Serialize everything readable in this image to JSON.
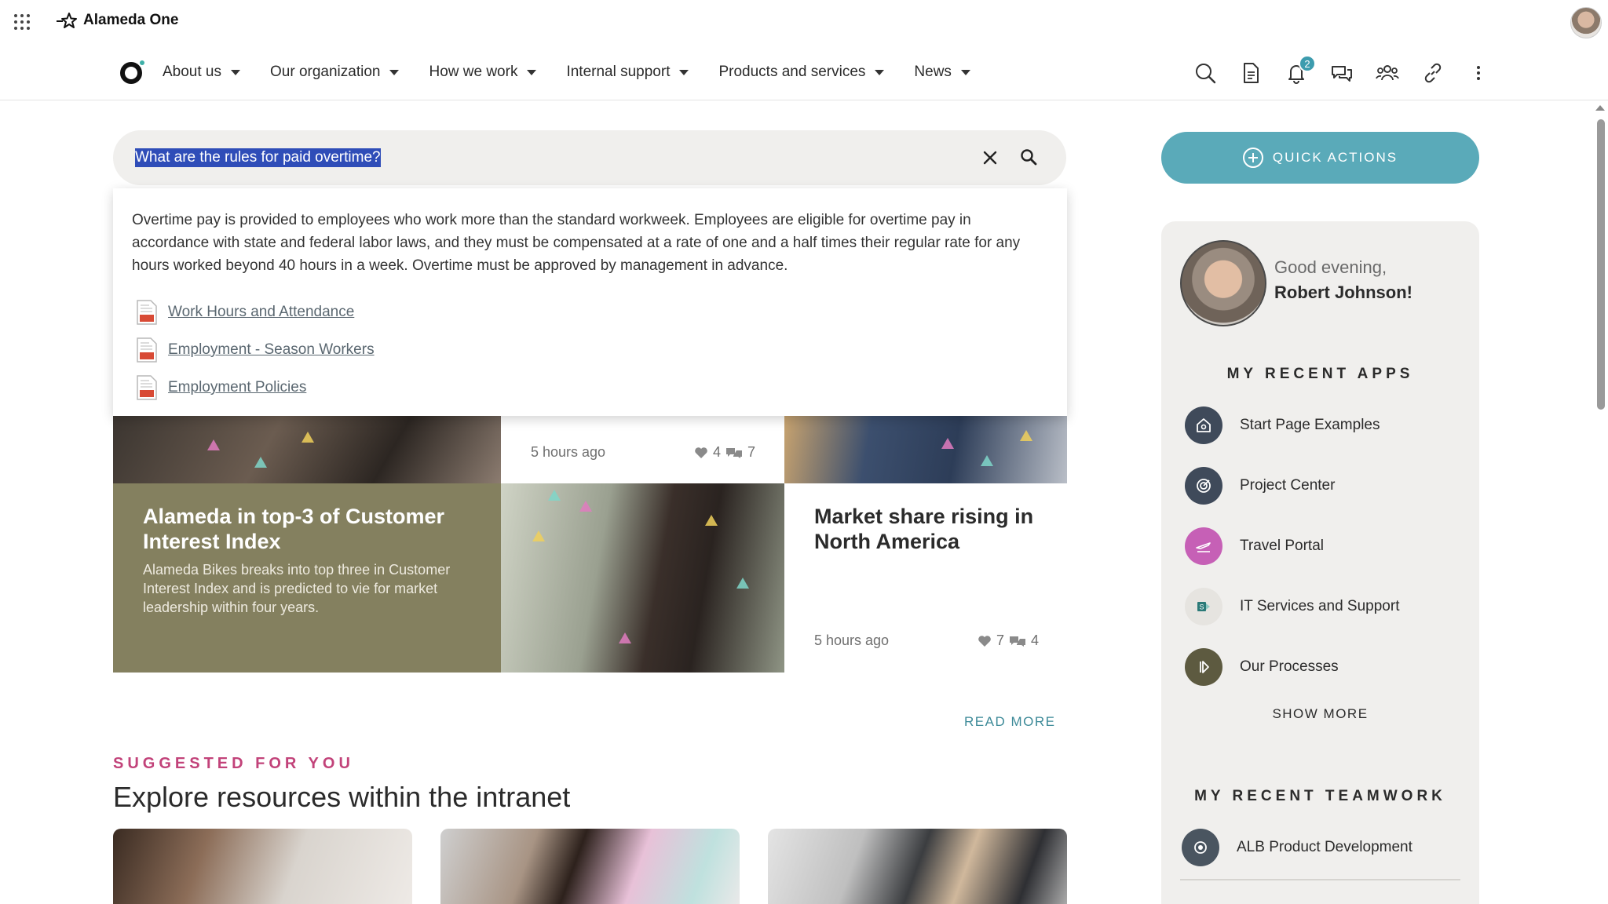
{
  "brand": {
    "name": "Alameda One"
  },
  "nav": {
    "items": [
      {
        "label": "About us"
      },
      {
        "label": "Our organization"
      },
      {
        "label": "How we work"
      },
      {
        "label": "Internal support"
      },
      {
        "label": "Products and services"
      },
      {
        "label": "News"
      }
    ],
    "notification_count": "2"
  },
  "search": {
    "query": "What are the rules for paid overtime?",
    "answer": "Overtime pay is provided to employees who work more than the standard workweek. Employees are eligible for overtime pay in accordance with state and federal labor laws, and they must be compensated at a rate of one and a half times their regular rate for any hours worked beyond 40 hours in a week. Overtime must be approved by management in advance.",
    "sources": [
      {
        "label": "Work Hours and Attendance"
      },
      {
        "label": "Employment - Season Workers"
      },
      {
        "label": "Employment Policies"
      }
    ]
  },
  "news": {
    "top_card": {
      "time": "5 hours ago",
      "likes": "4",
      "comments": "7"
    },
    "featured": {
      "title": "Alameda in top-3 of Customer Interest Index",
      "description": "Alameda Bikes breaks into top three in Customer Interest Index and is predicted to vie for market leadership within four years."
    },
    "card": {
      "title": "Market share rising in North America",
      "time": "5 hours ago",
      "likes": "7",
      "comments": "4"
    },
    "read_more": "READ MORE"
  },
  "suggested": {
    "kicker": "SUGGESTED FOR YOU",
    "title": "Explore resources within the intranet"
  },
  "quick_actions": {
    "label": "QUICK ACTIONS"
  },
  "profile": {
    "greeting": "Good evening,",
    "name": "Robert Johnson!"
  },
  "recent_apps": {
    "heading": "MY RECENT APPS",
    "items": [
      {
        "label": "Start Page Examples",
        "icon": "home-settings-icon",
        "color": "#3f4a5a"
      },
      {
        "label": "Project Center",
        "icon": "target-icon",
        "color": "#3f4a5a"
      },
      {
        "label": "Travel Portal",
        "icon": "plane-icon",
        "color": "#c660b6"
      },
      {
        "label": "IT Services and Support",
        "icon": "sharepoint-icon",
        "color": "#e6e4e0"
      },
      {
        "label": "Our Processes",
        "icon": "process-icon",
        "color": "#5d5a40"
      }
    ],
    "show_more": "SHOW MORE"
  },
  "recent_teamwork": {
    "heading": "MY RECENT TEAMWORK",
    "items": [
      {
        "label": "ALB Product Development",
        "icon": "team-icon",
        "color": "#4a5560"
      }
    ]
  },
  "colors": {
    "accent": "#5aaab9",
    "olive": "#84805f",
    "pink": "#c2437a",
    "link": "#3d8a98"
  }
}
